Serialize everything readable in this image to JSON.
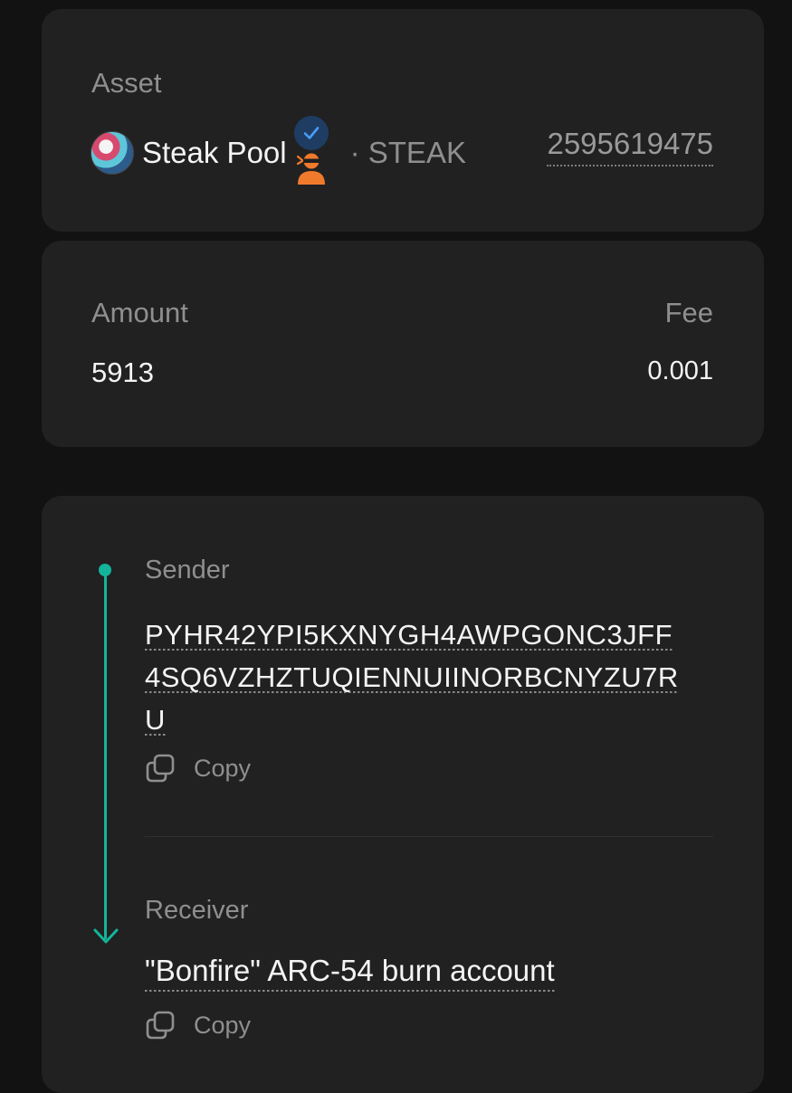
{
  "asset": {
    "label": "Asset",
    "name": "Steak Pool",
    "unit_name": "· STEAK",
    "asset_id": "2595619475",
    "icons": [
      "asset-logo-icon",
      "verified-check-icon",
      "ninja-creator-icon"
    ]
  },
  "amount": {
    "label": "Amount",
    "value": "5913",
    "fee_label": "Fee",
    "fee_value": "0.001"
  },
  "transfer": {
    "sender_label": "Sender",
    "sender_address_lines": [
      "PYHR42YPI5KXNYGH4AWPGONC3JFF",
      "4SQ6VZHZTUQIENNUIINORBCNYZU7R",
      "U"
    ],
    "sender_copy_label": "Copy",
    "receiver_label": "Receiver",
    "receiver_name": "\"Bonfire\" ARC-54 burn account",
    "receiver_copy_label": "Copy"
  },
  "colors": {
    "background": "#121212",
    "card": "#212121",
    "accent": "#14b49a",
    "muted_text": "#8f8f8f",
    "verified": "#4a9df8",
    "creator_badge": "#f07a2c"
  }
}
